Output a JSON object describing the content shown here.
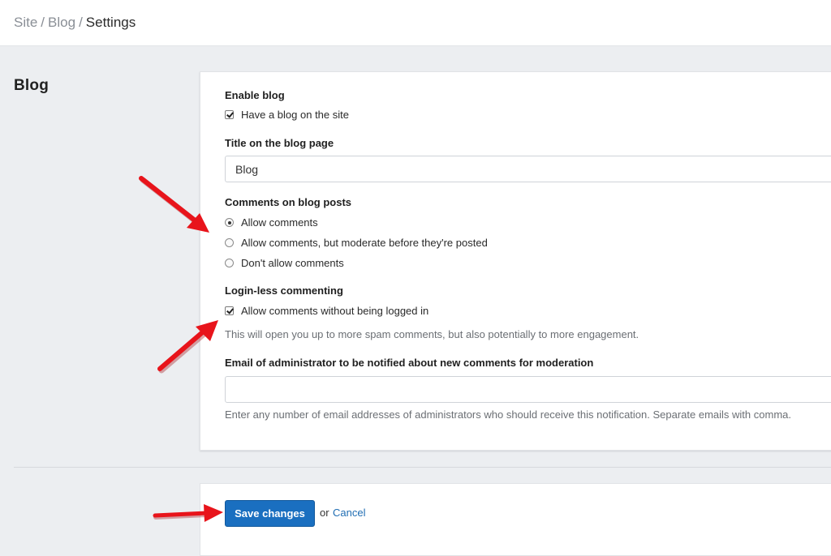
{
  "breadcrumb": {
    "items": [
      "Site",
      "Blog"
    ],
    "current": "Settings",
    "separator": "/"
  },
  "section": {
    "title": "Blog"
  },
  "form": {
    "enable_blog": {
      "label": "Enable blog",
      "checkbox_label": "Have a blog on the site",
      "checked": true
    },
    "title": {
      "label": "Title on the blog page",
      "value": "Blog",
      "placeholder": ""
    },
    "comments": {
      "label": "Comments on blog posts",
      "options": [
        {
          "label": "Allow comments",
          "selected": true
        },
        {
          "label": "Allow comments, but moderate before they're posted",
          "selected": false
        },
        {
          "label": "Don't allow comments",
          "selected": false
        }
      ]
    },
    "loginless": {
      "label": "Login-less commenting",
      "checkbox_label": "Allow comments without being logged in",
      "checked": true,
      "hint": "This will open you up to more spam comments, but also potentially to more engagement."
    },
    "admin_email": {
      "label": "Email of administrator to be notified about new comments for moderation",
      "value": "",
      "placeholder": "",
      "hint": "Enter any number of email addresses of administrators who should receive this notification. Separate emails with comma."
    }
  },
  "actions": {
    "save_label": "Save changes",
    "or_text": "or",
    "cancel_label": "Cancel"
  },
  "colors": {
    "accent": "#1a6fc0",
    "link": "#1f6db3",
    "annotation_arrow": "#e8141b",
    "page_background": "#eceef1"
  },
  "icons": {
    "annotation": "red-arrow-icon"
  }
}
